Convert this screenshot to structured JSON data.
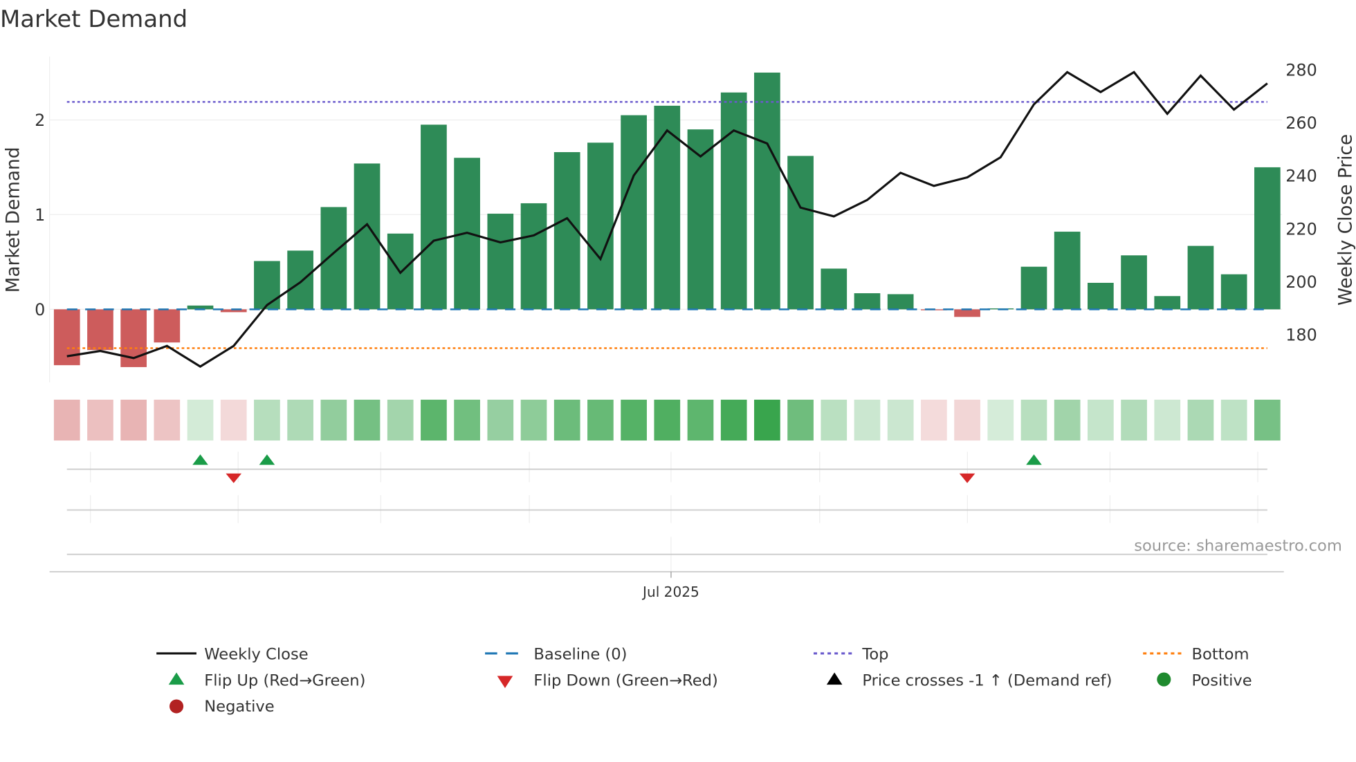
{
  "chart_data": {
    "type": "bar",
    "title": "Market Demand",
    "ylabel": "Market Demand",
    "y2label": "Weekly Close Price",
    "ylim": [
      -0.78,
      2.68
    ],
    "y2lim": [
      155,
      283
    ],
    "yticks": [
      "0",
      "1",
      "2"
    ],
    "y2ticks": [
      "180",
      "200",
      "220",
      "240",
      "260",
      "280"
    ],
    "xtick_label": "Jul 2025",
    "source": "source: sharemaestro.com",
    "reference_lines": {
      "baseline": 0,
      "top": 2.19,
      "bottom": -0.41
    },
    "demand": [
      -0.59,
      -0.43,
      -0.61,
      -0.35,
      0.04,
      -0.03,
      0.51,
      0.62,
      1.08,
      1.54,
      0.8,
      1.95,
      1.6,
      1.01,
      1.12,
      1.66,
      1.76,
      2.05,
      2.15,
      1.9,
      2.29,
      2.5,
      1.62,
      0.43,
      0.17,
      0.16,
      -0.01,
      -0.08,
      0.01,
      0.45,
      0.82,
      0.28,
      0.57,
      0.14,
      0.67,
      0.37,
      1.5
    ],
    "weekly_close": [
      171.8,
      173.8,
      171.1,
      175.7,
      167.9,
      175.7,
      191.1,
      199.7,
      210.8,
      221.6,
      203.3,
      215.4,
      218.4,
      214.8,
      217.4,
      223.9,
      208.5,
      240.0,
      257.0,
      247.2,
      257.0,
      252.1,
      227.9,
      224.6,
      230.8,
      241.0,
      236.1,
      239.3,
      246.9,
      266.9,
      279.0,
      271.5,
      279.0,
      263.3,
      277.7,
      264.9,
      274.8
    ],
    "flip_up_weeks": [
      5,
      7,
      30
    ],
    "flip_down_weeks": [
      6,
      28
    ],
    "colors": {
      "positive": "#2e8b57",
      "negative": "#cd5c5c",
      "line": "#111111",
      "baseline": "#1f77b4",
      "top": "#6a5acd",
      "bottom": "#ff7f0e",
      "flip_up": "#1a9c48",
      "flip_down": "#d62728"
    },
    "legend": {
      "weekly_close": "Weekly Close",
      "baseline": "Baseline (0)",
      "top": "Top",
      "bottom": "Bottom",
      "flip_up": "Flip Up (Red→Green)",
      "flip_down": "Flip Down (Green→Red)",
      "price_cross": "Price crosses -1 ↑ (Demand ref)",
      "positive": "Positive",
      "negative": "Negative"
    }
  }
}
